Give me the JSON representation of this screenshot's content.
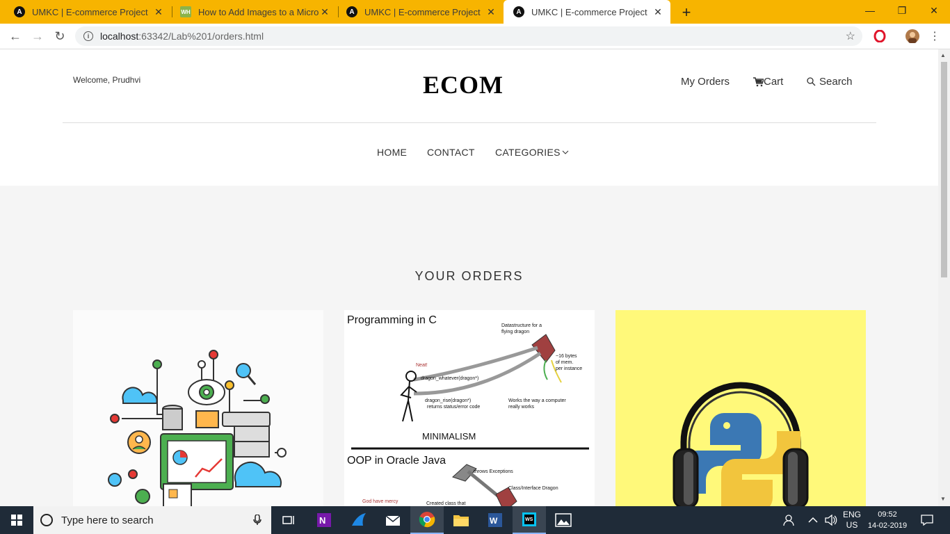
{
  "browser": {
    "tabs": [
      {
        "title": "UMKC | E-commerce Project",
        "favicon": "A"
      },
      {
        "title": "How to Add Images to a Microso",
        "favicon": "WH"
      },
      {
        "title": "UMKC | E-commerce Project",
        "favicon": "A"
      },
      {
        "title": "UMKC | E-commerce Project",
        "favicon": "A"
      }
    ],
    "url_host": "localhost",
    "url_rest": ":63342/Lab%201/orders.html"
  },
  "header": {
    "welcome": "Welcome, Prudhvi",
    "brand": "ECOM",
    "my_orders": "My Orders",
    "cart": "Cart",
    "search": "Search"
  },
  "menu": {
    "home": "HOME",
    "contact": "CONTACT",
    "categories": "CATEGORIES"
  },
  "orders": {
    "title": "YOUR ORDERS"
  },
  "card2": {
    "heading1": "Programming in C",
    "neat": "Neat!",
    "ds_line1": "Datastructure for a",
    "ds_line2": "flying dragon",
    "whatever": "dragon_whatever(dragon*)",
    "rise1": "dragon_rise(dragon*)",
    "rise2": "returns status/error code",
    "bytes1": "~16 bytes",
    "bytes2": "of mem.",
    "bytes3": "per instance",
    "works1": "Works the way a computer",
    "works2": "really works",
    "minimalism": "MINIMALISM",
    "heading2": "OOP in Oracle Java",
    "throws": "throws Exceptions",
    "classiface": "Class/Interface Dragon",
    "mercy": "God have mercy",
    "created": "Created class that"
  },
  "taskbar": {
    "search_placeholder": "Type here to search",
    "lang1": "ENG",
    "lang2": "US",
    "time": "09:52",
    "date": "14-02-2019"
  },
  "colors": {
    "chrome_tab_bar": "#f7b400",
    "taskbar": "#1f2b38",
    "card3_bg": "#fff97a"
  }
}
